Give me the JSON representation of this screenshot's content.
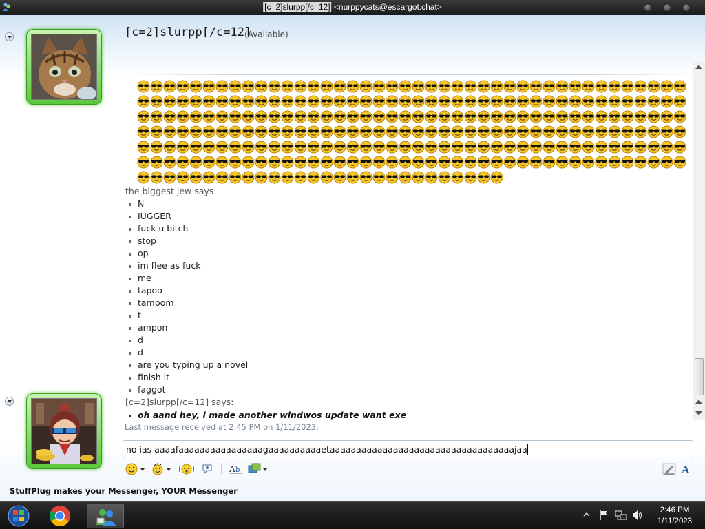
{
  "window": {
    "title_highlight": "[c=2]slurpp[/c=12]",
    "title_rest": " <nurppycats@escargot.chat>"
  },
  "contact": {
    "name": "[c=2]slurpp[/c=12]",
    "status": "(Available)"
  },
  "conversation": {
    "emoticon": "sunglasses-smiley",
    "emoticon_count": 280,
    "messages": [
      {
        "sender_says": "the biggest jew says:",
        "lines": [
          "N",
          "IUGGER",
          "fuck u bitch",
          "stop",
          "op",
          "im flee as fuck",
          "me",
          "tapoo",
          "tampom",
          "t",
          "ampon",
          "d",
          "d",
          "are you typing up a novel",
          "finish it",
          "faggot"
        ]
      },
      {
        "sender_says": "[c=2]slurpp[/c=12] says:",
        "lines": [
          "oh aand hey, i made another windwos update want exe"
        ]
      }
    ],
    "last_received": "Last message received at 2:45 PM on 1/11/2023."
  },
  "input": {
    "value": "no ias aaaafaaaaaaaaaaaaaaaagaaaaaaaaaaetaaaaaaaaaaaaaaaaaaaaaaaaaaaaaaaaaaajaa"
  },
  "toolbar": {
    "icons": [
      "emoticon-icon",
      "wink-icon",
      "nudge-icon",
      "voice-clip-icon",
      "font-ab-icon",
      "background-icon",
      "handwriting-icon",
      "font-color-icon"
    ]
  },
  "footer": {
    "status_text": "StuffPlug makes your Messenger, YOUR Messenger"
  },
  "taskbar": {
    "time": "2:46 PM",
    "date": "1/11/2023"
  },
  "colors": {
    "avatar_green": "#57c83a",
    "title_bar": "#1a1a1a",
    "taskbar": "#101010"
  }
}
